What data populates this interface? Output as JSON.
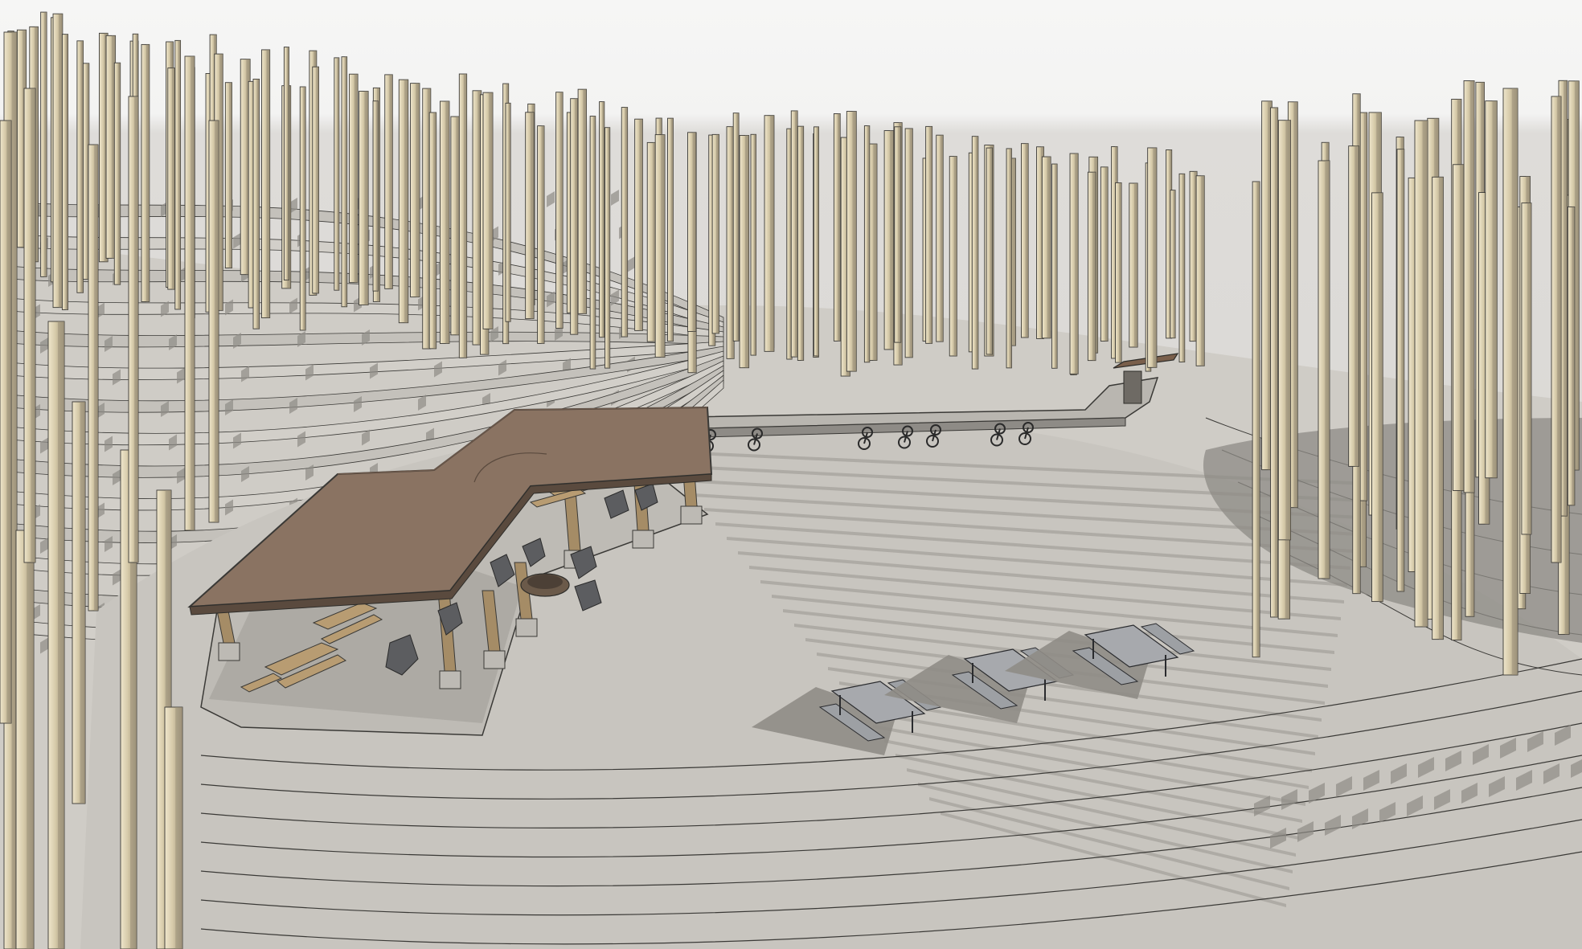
{
  "scene": {
    "subject": "sketch-render-amphitheater-park",
    "style": "hand-drawn architectural model rendering",
    "colors": {
      "sky_top": "#f6f6f5",
      "sky_band": "#dcdbd8",
      "ground": "#c9c6c0",
      "terrace_light": "#d2cfc9",
      "terrace_shadow": "#8e8b86",
      "pole_light": "#d8cdb0",
      "pole_shadow": "#9c927a",
      "outline": "#3a3936",
      "roof": "#8a7362",
      "roof_edge": "#5a4a3e",
      "timber": "#a58c66",
      "table": "#a7a9ad",
      "fire_ring": "#6b5a4a"
    },
    "picnic_tables_count": 3,
    "bike_rack_bikes_count": 7
  }
}
